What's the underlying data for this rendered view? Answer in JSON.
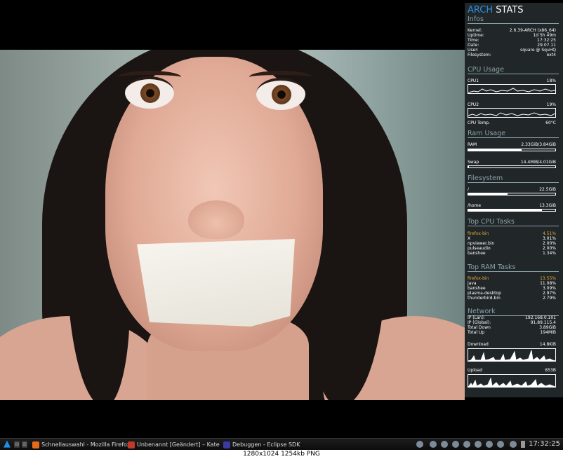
{
  "conky": {
    "title_a": "ARCH",
    "title_b": "STATS",
    "infos": {
      "heading": "Infos",
      "rows": [
        {
          "label": "Kernel:",
          "value": "2.6.39-ARCH (x86_64)"
        },
        {
          "label": "Uptime:",
          "value": "1d 5h 49m"
        },
        {
          "label": "Time:",
          "value": "17:32:25"
        },
        {
          "label": "Date:",
          "value": "29.07.11"
        },
        {
          "label": "User:",
          "value": "square @ SquHQ"
        },
        {
          "label": "Filesystem:",
          "value": "ext4"
        }
      ]
    },
    "cpu": {
      "heading": "CPU Usage",
      "cpu1_label": "CPU1",
      "cpu1_value": "18%",
      "cpu1_pct": 18,
      "cpu2_label": "CPU2",
      "cpu2_value": "19%",
      "cpu2_pct": 19,
      "temp_label": "CPU Temp.",
      "temp_value": "60°C"
    },
    "ram": {
      "heading": "Ram Usage",
      "ram_label": "RAM",
      "ram_value": "2.33GiB/3.84GiB",
      "ram_pct": 61,
      "swap_label": "Swap",
      "swap_value": "14.4MiB/4.01GiB",
      "swap_pct": 1
    },
    "fs": {
      "heading": "Filesystem",
      "root_label": "/",
      "root_value": "22.5GiB",
      "root_pct": 45,
      "home_label": "/home",
      "home_value": "13.3GiB",
      "home_pct": 85
    },
    "top_cpu": {
      "heading": "Top CPU Tasks",
      "rows": [
        {
          "label": "firefox-bin",
          "value": "4.51%"
        },
        {
          "label": "X",
          "value": "3.01%"
        },
        {
          "label": "npviewer.bin",
          "value": "2.00%"
        },
        {
          "label": "pulseaudio",
          "value": "2.00%"
        },
        {
          "label": "banshee",
          "value": "1.34%"
        }
      ]
    },
    "top_ram": {
      "heading": "Top RAM Tasks",
      "rows": [
        {
          "label": "firefox-bin",
          "value": "13.55%"
        },
        {
          "label": "java",
          "value": "11.08%"
        },
        {
          "label": "banshee",
          "value": "3.09%"
        },
        {
          "label": "plasma-desktop",
          "value": "2.97%"
        },
        {
          "label": "thunderbird-bin",
          "value": "2.79%"
        }
      ]
    },
    "network": {
      "heading": "Network",
      "rows": [
        {
          "label": "IP (Lan):",
          "value": "192.168.0.101"
        },
        {
          "label": "IP (Global):",
          "value": "91.89.115.4"
        },
        {
          "label": "Total Down",
          "value": "3.89GiB"
        },
        {
          "label": "Total Up",
          "value": "194MiB"
        }
      ],
      "download_label": "Download",
      "download_value": "14.8KiB",
      "upload_label": "Upload",
      "upload_value": "853B"
    }
  },
  "taskbar": {
    "tasks": [
      {
        "label": "Schnellauswahl - Mozilla Firefox",
        "color": "#e66a1e"
      },
      {
        "label": "Unbenannt [Geändert] – Kate",
        "color": "#c03a2a"
      },
      {
        "label": "Debuggen - Eclipse SDK",
        "color": "#3a3aa0"
      }
    ],
    "clock": "17:32:25"
  },
  "caption": "1280x1024  1254kb  PNG"
}
